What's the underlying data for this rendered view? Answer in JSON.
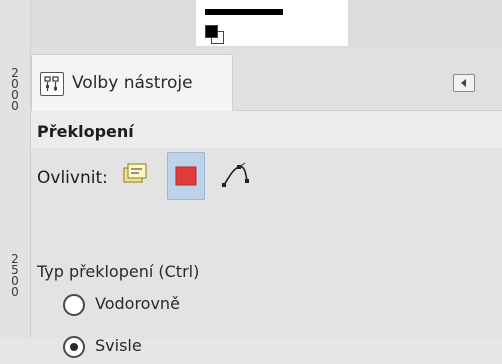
{
  "ruler": {
    "top_value": "2000",
    "bottom_value": "2500"
  },
  "colors": {
    "accent_active": "#bcd3ea",
    "selection_red": "#e03a3a"
  },
  "dockable": {
    "tab_label": "Volby nástroje",
    "tab_icon": "tool-options-icon",
    "menu_icon": "tab-menu-arrow-icon"
  },
  "tool_options": {
    "title": "Překlopení",
    "affect_label": "Ovlivnit:",
    "affect_options": [
      {
        "name": "layer",
        "icon": "layer-icon",
        "active": false
      },
      {
        "name": "selection",
        "icon": "selection-icon",
        "active": true
      },
      {
        "name": "path",
        "icon": "path-icon",
        "active": false
      }
    ],
    "flip_type_label": "Typ překlopení  (Ctrl)",
    "flip_types": [
      {
        "label": "Vodorovně",
        "selected": false
      },
      {
        "label": "Svisle",
        "selected": true
      }
    ]
  }
}
